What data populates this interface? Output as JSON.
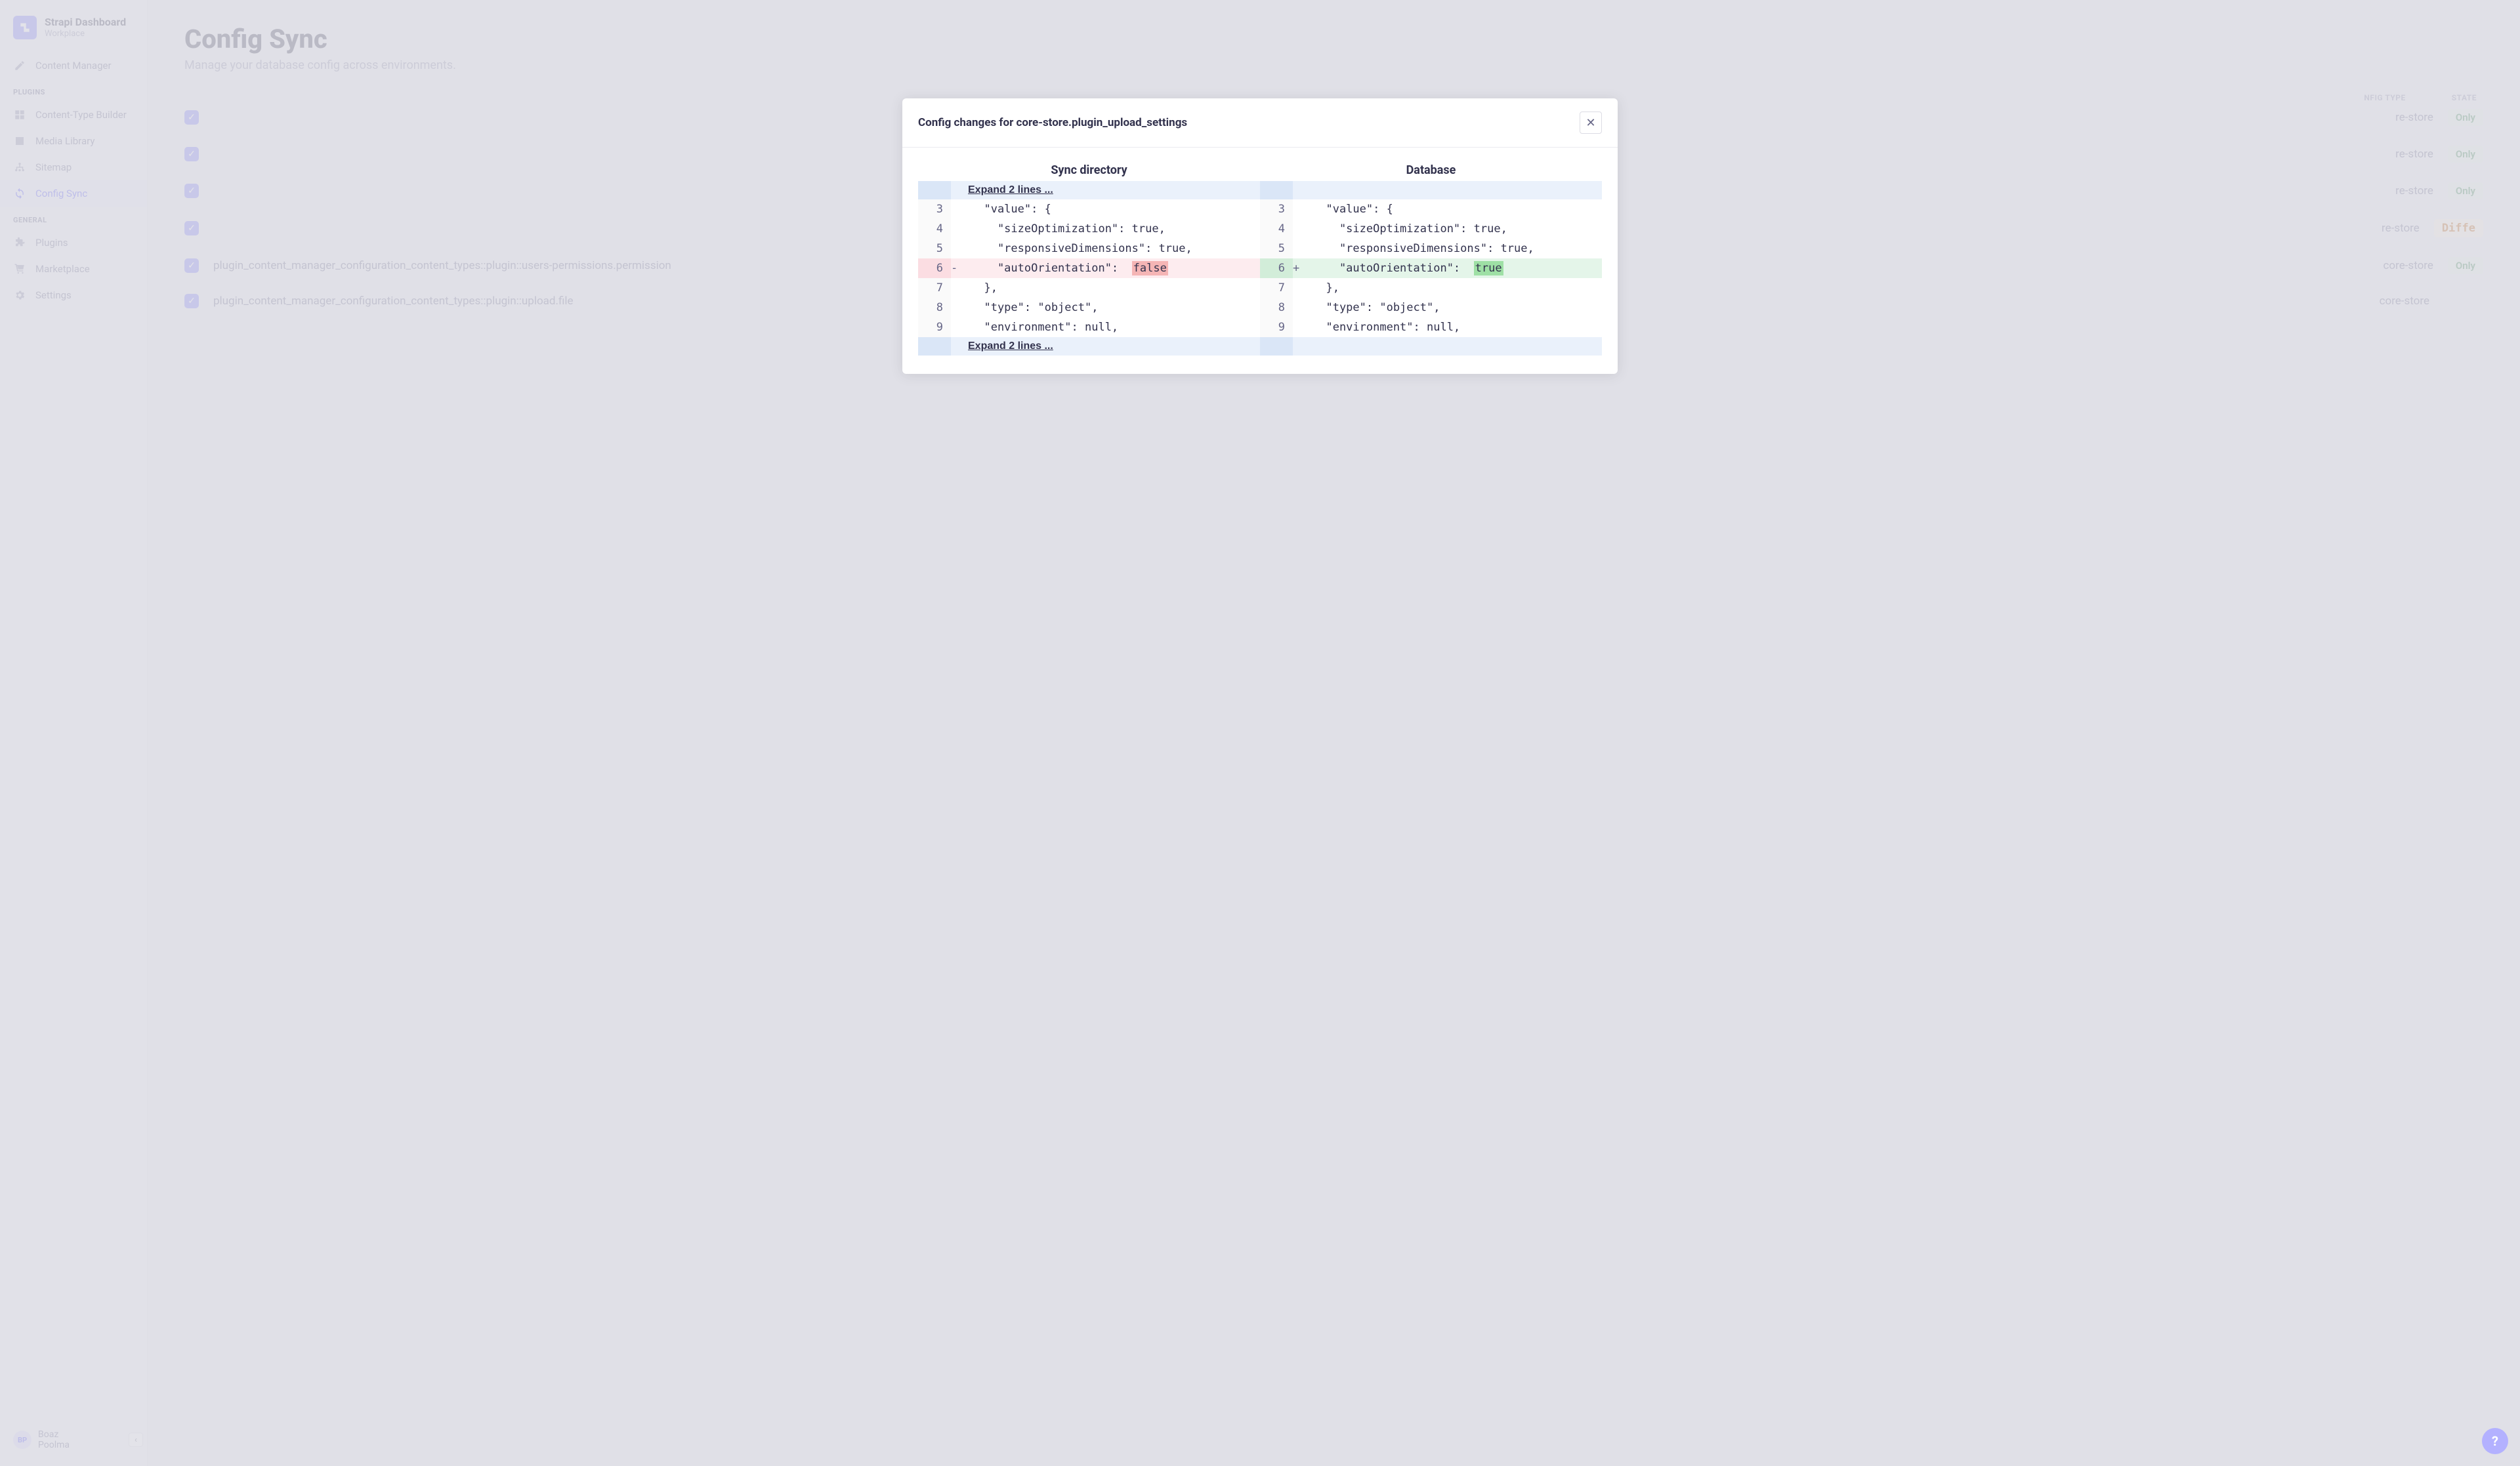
{
  "brand": {
    "title": "Strapi Dashboard",
    "subtitle": "Workplace"
  },
  "nav": {
    "top": [
      {
        "label": "Content Manager",
        "icon": "pencil"
      }
    ],
    "plugins_label": "PLUGINS",
    "plugins": [
      {
        "label": "Content-Type Builder",
        "icon": "grid"
      },
      {
        "label": "Media Library",
        "icon": "image"
      },
      {
        "label": "Sitemap",
        "icon": "sitemap"
      },
      {
        "label": "Config Sync",
        "icon": "sync",
        "active": true
      }
    ],
    "general_label": "GENERAL",
    "general": [
      {
        "label": "Plugins",
        "icon": "puzzle"
      },
      {
        "label": "Marketplace",
        "icon": "cart"
      },
      {
        "label": "Settings",
        "icon": "gear"
      }
    ]
  },
  "user": {
    "initials": "BP",
    "line1": "Boaz",
    "line2": "Poolma"
  },
  "page": {
    "title": "Config Sync",
    "subtitle": "Manage your database config across environments."
  },
  "columns": {
    "type": "NFIG TYPE",
    "state": "STATE"
  },
  "rows": [
    {
      "name": "",
      "type": "re-store",
      "state": "Only",
      "stateClass": "only"
    },
    {
      "name": "",
      "type": "re-store",
      "state": "Only",
      "stateClass": "only"
    },
    {
      "name": "",
      "type": "re-store",
      "state": "Only",
      "stateClass": "only"
    },
    {
      "name": "",
      "type": "re-store",
      "state": "Diffe",
      "stateClass": "diff"
    },
    {
      "name": "plugin_content_manager_configuration_content_types::plugin::users-permissions.permission",
      "type": "core-store",
      "state": "Only",
      "stateClass": "only"
    },
    {
      "name": "plugin_content_manager_configuration_content_types::plugin::upload.file",
      "type": "core-store",
      "state": "",
      "stateClass": ""
    }
  ],
  "modal": {
    "title": "Config changes for core-store.plugin_upload_settings",
    "left_header": "Sync directory",
    "right_header": "Database",
    "expand_label": "Expand 2 lines ...",
    "diff": [
      {
        "ln": 3,
        "l": "  \"value\": {",
        "r": "  \"value\": {"
      },
      {
        "ln": 4,
        "l": "    \"sizeOptimization\": true,",
        "r": "    \"sizeOptimization\": true,"
      },
      {
        "ln": 5,
        "l": "    \"responsiveDimensions\": true,",
        "r": "    \"responsiveDimensions\": true,"
      },
      {
        "ln": 6,
        "l_pre": "    \"autoOrientation\":  ",
        "l_hl": "false",
        "r_pre": "    \"autoOrientation\":  ",
        "r_hl": "true",
        "changed": true
      },
      {
        "ln": 7,
        "l": "  },",
        "r": "  },"
      },
      {
        "ln": 8,
        "l": "  \"type\": \"object\",",
        "r": "  \"type\": \"object\","
      },
      {
        "ln": 9,
        "l": "  \"environment\": null,",
        "r": "  \"environment\": null,"
      }
    ]
  },
  "help": "?"
}
